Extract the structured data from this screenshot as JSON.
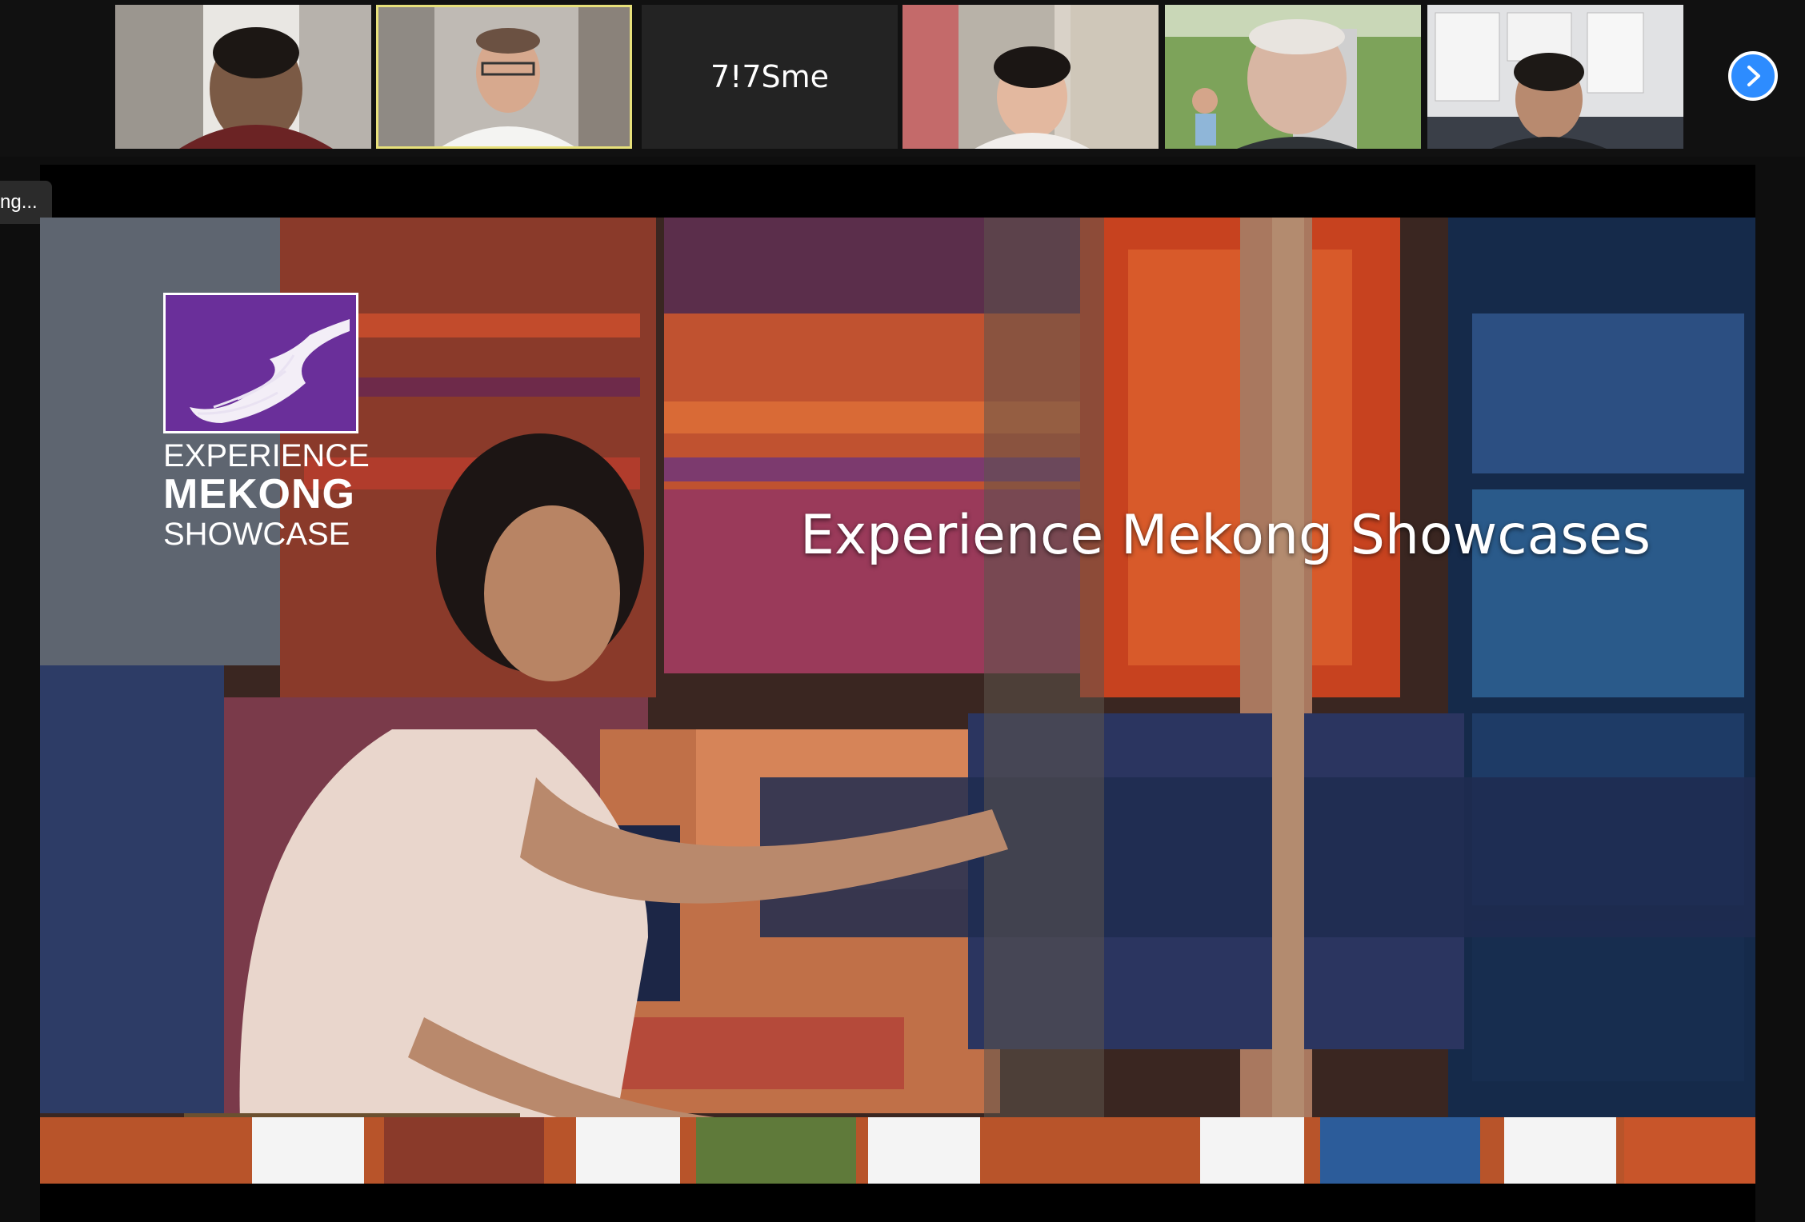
{
  "gallery": {
    "tiles": [
      {
        "kind": "video",
        "label": ""
      },
      {
        "kind": "video",
        "label": "",
        "active": true
      },
      {
        "kind": "name",
        "label": "7!7Sme"
      },
      {
        "kind": "video",
        "label": ""
      },
      {
        "kind": "video",
        "label": ""
      },
      {
        "kind": "video",
        "label": ""
      }
    ],
    "next_icon": "chevron-right-icon",
    "active_color": "#e7e07a",
    "next_color": "#2d8cff"
  },
  "share": {
    "status_text": "ng...",
    "slide": {
      "logo": {
        "line1": "EXPERIENCE",
        "line2": "MEKONG",
        "line3": "SHOWCASE",
        "box_color": "#6a2f9a"
      },
      "title": "Experience Mekong Showcases"
    }
  }
}
